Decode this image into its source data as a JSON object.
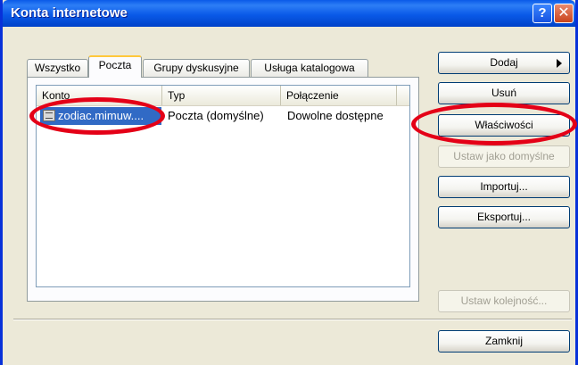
{
  "window": {
    "title": "Konta internetowe",
    "help_symbol": "?",
    "close_symbol": "✕"
  },
  "tabs": [
    {
      "label": "Wszystko",
      "active": false
    },
    {
      "label": "Poczta",
      "active": true
    },
    {
      "label": "Grupy dyskusyjne",
      "active": false
    },
    {
      "label": "Usługa katalogowa",
      "active": false
    }
  ],
  "list": {
    "columns": [
      "Konto",
      "Typ",
      "Połączenie"
    ],
    "rows": [
      {
        "account": "zodiac.mimuw....",
        "type": "Poczta (domyślne)",
        "connection": "Dowolne dostępne",
        "selected": true
      }
    ]
  },
  "buttons": {
    "add": "Dodaj",
    "remove": "Usuń",
    "properties": "Właściwości",
    "set_default": "Ustaw jako domyślne",
    "import": "Importuj...",
    "export": "Eksportuj...",
    "set_order": "Ustaw kolejność...",
    "close": "Zamknij"
  },
  "colors": {
    "title_bar": "#0a5ae8",
    "selection": "#316ac5",
    "highlight_annotation": "#e40017",
    "window_face": "#ece9d8"
  }
}
